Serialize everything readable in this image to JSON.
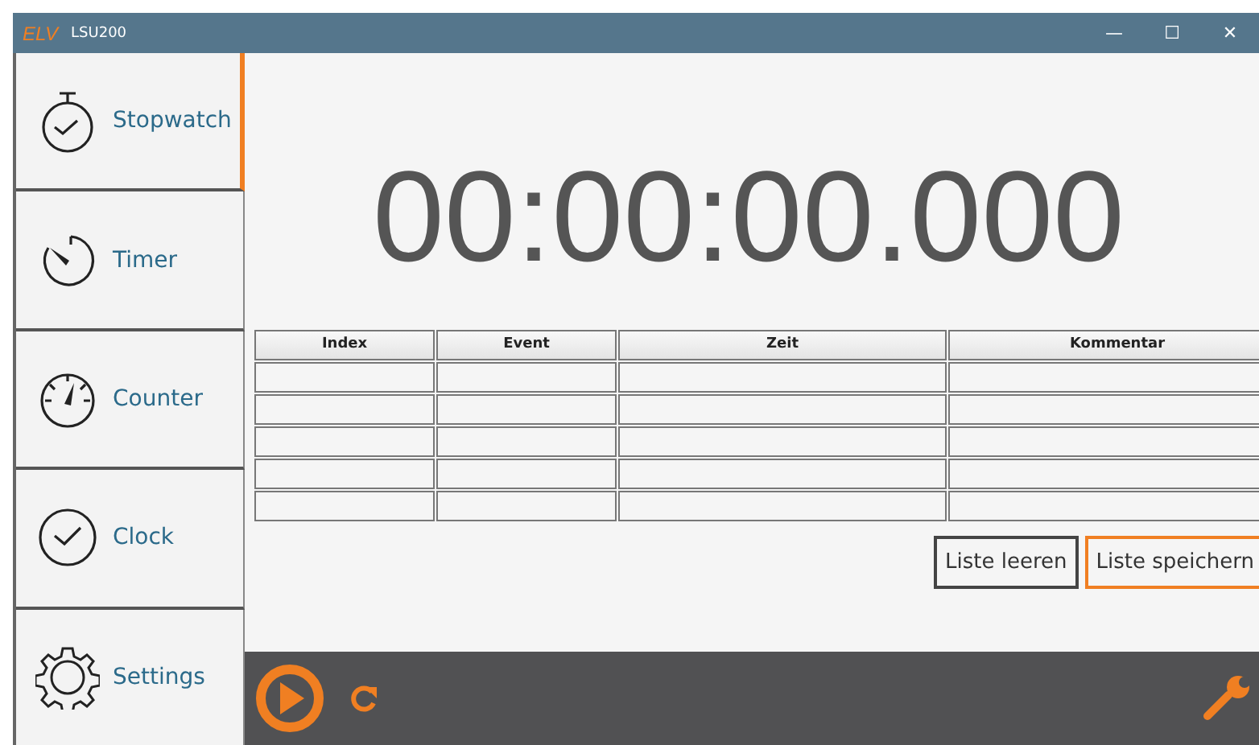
{
  "window": {
    "title": "LSU200",
    "logo": "ELV",
    "controls": [
      "—",
      "☐",
      "✕"
    ]
  },
  "sidebar": {
    "items": [
      {
        "label": "Stopwatch",
        "kind": "stopwatch",
        "selected": true
      },
      {
        "label": "Timer",
        "kind": "timer",
        "selected": false
      },
      {
        "label": "Counter",
        "kind": "counter",
        "selected": false
      },
      {
        "label": "Clock",
        "kind": "clock",
        "selected": false
      },
      {
        "label": "Settings",
        "kind": "settings",
        "selected": false
      }
    ]
  },
  "display": {
    "time": "00:00:00.000"
  },
  "table": {
    "columns": [
      "Index",
      "Event",
      "Zeit",
      "Kommentar"
    ]
  },
  "buttons": [
    {
      "label": "Liste leeren",
      "selected": false
    },
    {
      "label": "Liste speichern",
      "selected": true
    }
  ]
}
